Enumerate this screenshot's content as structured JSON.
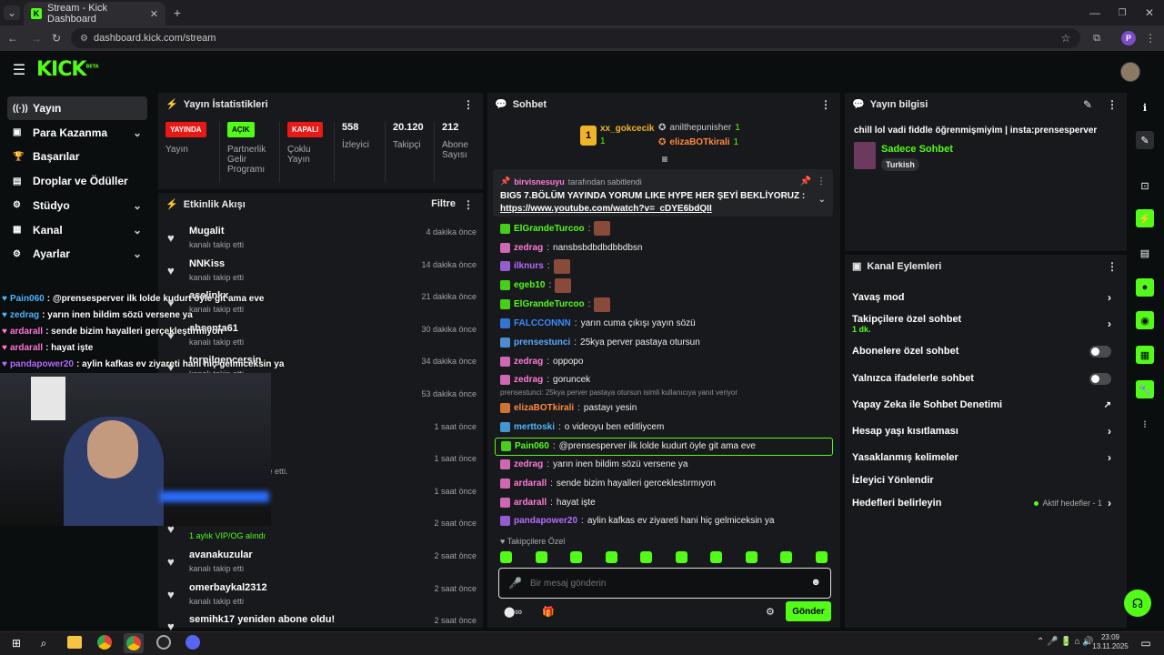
{
  "browser": {
    "tab_title": "Stream - Kick Dashboard",
    "url": "dashboard.kick.com/stream",
    "profile_initial": "P"
  },
  "header": {
    "logo": "KICK",
    "beta": "BETA"
  },
  "sidebar": {
    "items": [
      {
        "label": "Yayın",
        "icon": "broadcast-icon",
        "chev": false
      },
      {
        "label": "Para Kazanma",
        "icon": "money-icon",
        "chev": true
      },
      {
        "label": "Başarılar",
        "icon": "trophy-icon",
        "chev": false
      },
      {
        "label": "Droplar ve Ödüller",
        "icon": "gift-icon",
        "chev": false
      },
      {
        "label": "Stüdyo",
        "icon": "gear-icon",
        "chev": true
      },
      {
        "label": "Kanal",
        "icon": "grid-icon",
        "chev": true
      },
      {
        "label": "Ayarlar",
        "icon": "settings-icon",
        "chev": true
      }
    ]
  },
  "stats": {
    "title": "Yayın İstatistikleri",
    "items": [
      {
        "pill": "YAYINDA",
        "pill_color": "#e91916",
        "label": "Yayın"
      },
      {
        "pill": "AÇIK",
        "pill_color": "#53fc18",
        "label": "Partnerlik Gelir Programı"
      },
      {
        "pill": "KAPALI",
        "pill_color": "#e91916",
        "label": "Çoklu Yayın"
      },
      {
        "value": "558",
        "label": "İzleyici"
      },
      {
        "value": "20.120",
        "label": "Takipçi"
      },
      {
        "value": "212",
        "label": "Abone Sayısı"
      }
    ]
  },
  "activity": {
    "title": "Etkinlik Akışı",
    "filter": "Filtre",
    "events": [
      {
        "name": "Mugalit",
        "sub": "kanalı takip etti",
        "time": "4 dakika önce"
      },
      {
        "name": "NNKiss",
        "sub": "kanalı takip etti",
        "time": "14 dakika önce"
      },
      {
        "name": "aselinkx",
        "sub": "kanalı takip etti",
        "time": "21 dakika önce"
      },
      {
        "name": "absenta61",
        "sub": "kanalı takip etti",
        "time": "30 dakika önce"
      },
      {
        "name": "torpilgencersin",
        "sub": "kanalı takip etti",
        "time": "34 dakika önce"
      },
      {
        "name": "",
        "sub": "",
        "time": "53 dakika önce"
      },
      {
        "name": "",
        "sub": "",
        "time": "1 saat önce"
      },
      {
        "name": "",
        "sub": "...ıcıya abonelik hediye etti.",
        "time": "1 saat önce"
      },
      {
        "name": "",
        "sub": "",
        "time": "1 saat önce"
      },
      {
        "name": "",
        "sub": "1 aylık VIP/OG alındı",
        "time": "2 saat önce"
      },
      {
        "name": "avanakuzular",
        "sub": "kanalı takip etti",
        "time": "2 saat önce"
      },
      {
        "name": "omerbaykal2312",
        "sub": "kanalı takip etti",
        "time": "2 saat önce"
      },
      {
        "name": "semihk17 yeniden abone oldu!",
        "sub": "",
        "time": "2 saat önce"
      }
    ]
  },
  "chat": {
    "title": "Sohbet",
    "top": [
      {
        "rank": "1",
        "name": "xx_gokcecik",
        "count": "1"
      },
      {
        "name": "anilthepunisher",
        "count": "1"
      },
      {
        "name": "elizaBOTkirali",
        "count": "1"
      }
    ],
    "pinned": {
      "by_user": "birvisnesuyu",
      "by_text": "tarafından sabitlendi",
      "text": "BIG5 7.BÖLÜM YAYINDA YORUM LIKE HYPE HER ŞEYİ BEKLİYORUZ :",
      "link": "https://www.youtube.com/watch?v=_cDYE6bdQII"
    },
    "messages": [
      {
        "user": "ElGrandeTurcoo",
        "color": "#53fc18",
        "text": "",
        "emote": true
      },
      {
        "user": "zedrag",
        "color": "#ff7ad9",
        "text": "nansbsbdbdbdbbdbsn"
      },
      {
        "user": "ilknurs",
        "color": "#b66bff",
        "text": "",
        "emote": true
      },
      {
        "user": "egeb10",
        "color": "#53fc18",
        "text": "",
        "emote": true
      },
      {
        "user": "ElGrandeTurcoo",
        "color": "#53fc18",
        "text": "",
        "emote": true
      },
      {
        "user": "FALCCONNN",
        "color": "#3b8cff",
        "text": "yarın cuma çıkışı yayın sözü"
      },
      {
        "user": "prensestunci",
        "color": "#5aa9ff",
        "text": "25kya perver pastaya otursun"
      },
      {
        "user": "zedrag",
        "color": "#ff7ad9",
        "text": "oppopo"
      },
      {
        "user": "zedrag",
        "color": "#ff7ad9",
        "text": "goruncek"
      },
      {
        "user": "elizaBOTkirali",
        "color": "#ff8a3d",
        "text": "pastayı yesin",
        "reply": "prensestunci: 25kya perver pastaya otursun isimli kullanıcıya yanıt veriyor"
      },
      {
        "user": "merttoski",
        "color": "#4fb7ff",
        "text": "o videoyu ben editliycem"
      },
      {
        "user": "Pain060",
        "color": "#53fc18",
        "text": "@prensesperver ilk lolde kudurt öyle git ama eve",
        "highlight": true
      },
      {
        "user": "zedrag",
        "color": "#ff7ad9",
        "text": "yarın inen bildim sözü versene ya"
      },
      {
        "user": "ardarall",
        "color": "#ff7ad9",
        "text": "sende bizim hayalleri gerceklestırmıyon"
      },
      {
        "user": "ardarall",
        "color": "#ff7ad9",
        "text": "hayat işte"
      },
      {
        "user": "pandapower20",
        "color": "#b66bff",
        "text": "aylin kafkas ev ziyareti hani hiç gelmiceksin ya"
      }
    ],
    "followers_only": "Takipçilere Özel",
    "placeholder": "Bir mesaj gönderin",
    "send": "Gönder"
  },
  "overlay": [
    {
      "user": "Pain060",
      "text": ": @prensesperver ilk lolde kudurt öyle git ama eve",
      "color": "#4fb7ff"
    },
    {
      "user": "zedrag",
      "text": ": yarın inen bildim sözü versene ya",
      "color": "#4fb7ff"
    },
    {
      "user": "ardarall",
      "text": ": sende bizim hayalleri gerçekleştirmiyon",
      "color": "#ff7ad9"
    },
    {
      "user": "ardarall",
      "text": ": hayat işte",
      "color": "#ff7ad9"
    },
    {
      "user": "pandapower20",
      "text": ": aylin kafkas ev ziyareti hani hiç gelmiceksin ya",
      "color": "#b66bff"
    }
  ],
  "info": {
    "title": "Yayın bilgisi",
    "stream_title": "chill lol vadi fiddle öğrenmişmiyim | insta:prensesperver",
    "category": "Sadece Sohbet",
    "tag": "Turkish"
  },
  "actions": {
    "title": "Kanal Eylemleri",
    "rows": [
      {
        "label": "Yavaş mod",
        "type": "arrow"
      },
      {
        "label": "Takipçilere özel sohbet",
        "sub": "1 dk.",
        "type": "arrow"
      },
      {
        "label": "Abonelere özel sohbet",
        "type": "toggle"
      },
      {
        "label": "Yalnızca ifadelerle sohbet",
        "type": "toggle"
      },
      {
        "label": "Yapay Zeka ile Sohbet Denetimi",
        "type": "ext"
      },
      {
        "label": "Hesap yaşı kısıtlaması",
        "type": "arrow"
      },
      {
        "label": "Yasaklanmış kelimeler",
        "type": "arrow"
      },
      {
        "label": "İzleyici Yönlendir",
        "type": "none"
      },
      {
        "label": "Hedefleri belirleyin",
        "type": "arrow",
        "extra": "Aktif hedefler - 1"
      }
    ]
  },
  "taskbar": {
    "time": "23:09",
    "date": "13.11.2025"
  },
  "colors": {
    "accent": "#53fc18",
    "panel": "#18191c",
    "bg": "#0b0e0f"
  }
}
